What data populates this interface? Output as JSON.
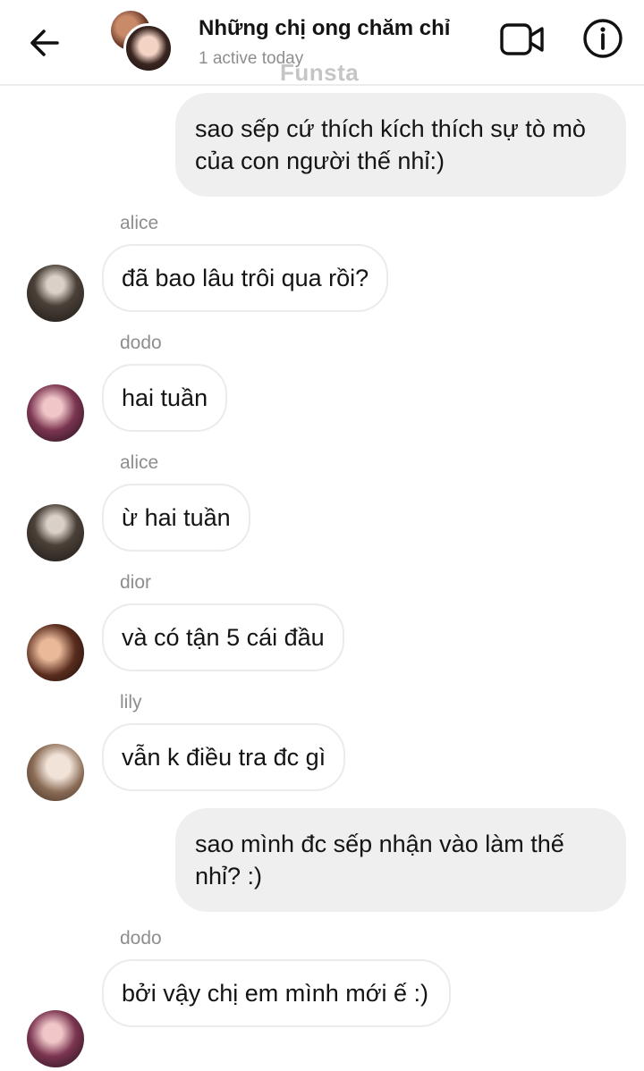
{
  "header": {
    "title": "Những chị ong chăm chỉ",
    "status": "1 active today",
    "watermark": "Funsta",
    "back_icon": "arrow-left-icon",
    "video_icon": "video-camera-icon",
    "info_icon": "info-icon"
  },
  "messages": [
    {
      "direction": "outgoing",
      "text": "sao sếp cứ thích kích thích sự tò mò của con người thế nhỉ:)"
    },
    {
      "direction": "incoming",
      "sender": "alice",
      "text": "đã bao lâu trôi qua rồi?"
    },
    {
      "direction": "incoming",
      "sender": "dodo",
      "text": "hai tuần"
    },
    {
      "direction": "incoming",
      "sender": "alice",
      "text": "ừ hai tuần"
    },
    {
      "direction": "incoming",
      "sender": "dior",
      "text": "và có tận 5 cái đầu"
    },
    {
      "direction": "incoming",
      "sender": "lily",
      "text": "vẫn k điều tra đc gì"
    },
    {
      "direction": "outgoing",
      "text": "sao mình đc sếp nhận vào làm thế nhỉ? :)"
    },
    {
      "direction": "incoming",
      "sender": "dodo",
      "text": "bởi vậy chị em mình mới ế :)"
    }
  ]
}
